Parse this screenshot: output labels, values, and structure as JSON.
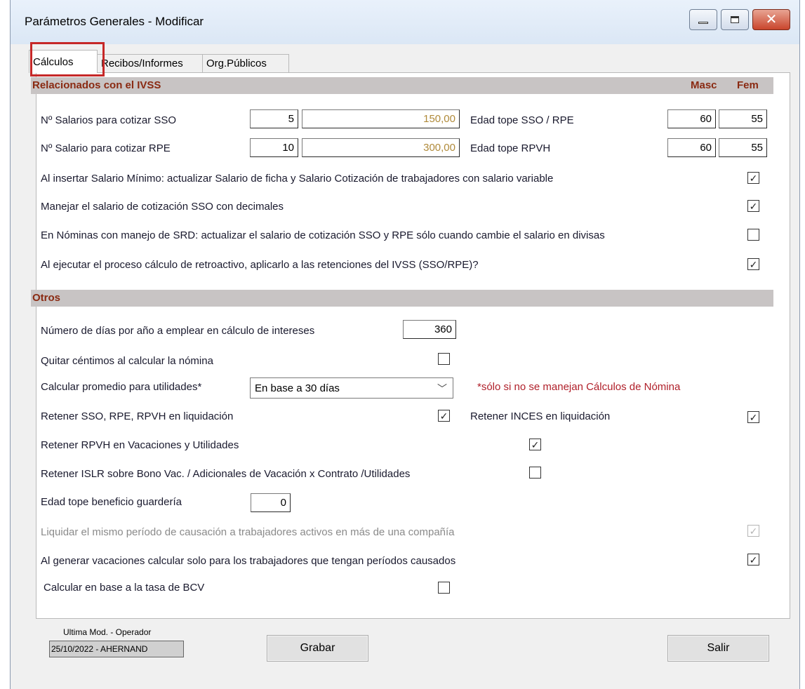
{
  "window": {
    "title": "Parámetros Generales - Modificar"
  },
  "tabs": [
    {
      "label": "Cálculos"
    },
    {
      "label": "Recibos/Informes"
    },
    {
      "label": "Org.Públicos"
    }
  ],
  "ivss": {
    "section_title": "Relacionados con el IVSS",
    "col_masc": "Masc",
    "col_fem": "Fem",
    "sso_label": "Nº Salarios para cotizar SSO",
    "sso_value": "5",
    "sso_amount": "150,00",
    "rpe_label": "Nº Salario para cotizar RPE",
    "rpe_value": "10",
    "rpe_amount": "300,00",
    "edad_sso_label": "Edad tope SSO / RPE",
    "edad_sso_masc": "60",
    "edad_sso_fem": "55",
    "edad_rpvh_label": "Edad tope RPVH",
    "edad_rpvh_masc": "60",
    "edad_rpvh_fem": "55",
    "options": [
      {
        "label": "Al insertar Salario Mínimo: actualizar Salario de ficha y Salario Cotización de trabajadores con  salario variable",
        "checked": true
      },
      {
        "label": "Manejar el salario de cotización SSO con decimales",
        "checked": true
      },
      {
        "label": "En Nóminas con manejo de SRD: actualizar el salario de cotización SSO y RPE sólo cuando cambie el salario en divisas",
        "checked": false
      },
      {
        "label": "Al ejecutar el proceso cálculo de retroactivo, aplicarlo a las retenciones del IVSS (SSO/RPE)?",
        "checked": true
      }
    ]
  },
  "otros": {
    "section_title": "Otros",
    "dias_label": "Número de días por año a emplear en cálculo de intereses",
    "dias_value": "360",
    "quitar_label": "Quitar céntimos al calcular la nómina",
    "promedio_label": "Calcular promedio para utilidades*",
    "promedio_selected": "En base a 30 días",
    "promedio_note": "*sólo si no se manejan Cálculos de Nómina",
    "retener_sso_label": "Retener SSO, RPE, RPVH en liquidación",
    "retener_inces_label": "Retener INCES en liquidación",
    "retener_rpvh_label": "Retener RPVH en Vacaciones y Utilidades",
    "retener_islr_label": "Retener ISLR sobre Bono Vac. / Adicionales de Vacación x Contrato /Utilidades",
    "edad_guarderia_label": "Edad tope beneficio guardería",
    "edad_guarderia_value": "0",
    "liquidar_label": "Liquidar el mismo período de causación a trabajadores activos en más de una compañía",
    "vacaciones_label": "Al generar vacaciones calcular solo para los trabajadores que tengan períodos causados",
    "bcv_label": "Calcular en base a la tasa de BCV"
  },
  "footer": {
    "mod_label": "Ultima Mod. - Operador",
    "mod_value": "25/10/2022 - AHERNAND",
    "save_label": "Grabar",
    "exit_label": "Salir"
  },
  "glyphs": {
    "check": "✓",
    "chevron": "﹀",
    "close": "✕"
  }
}
